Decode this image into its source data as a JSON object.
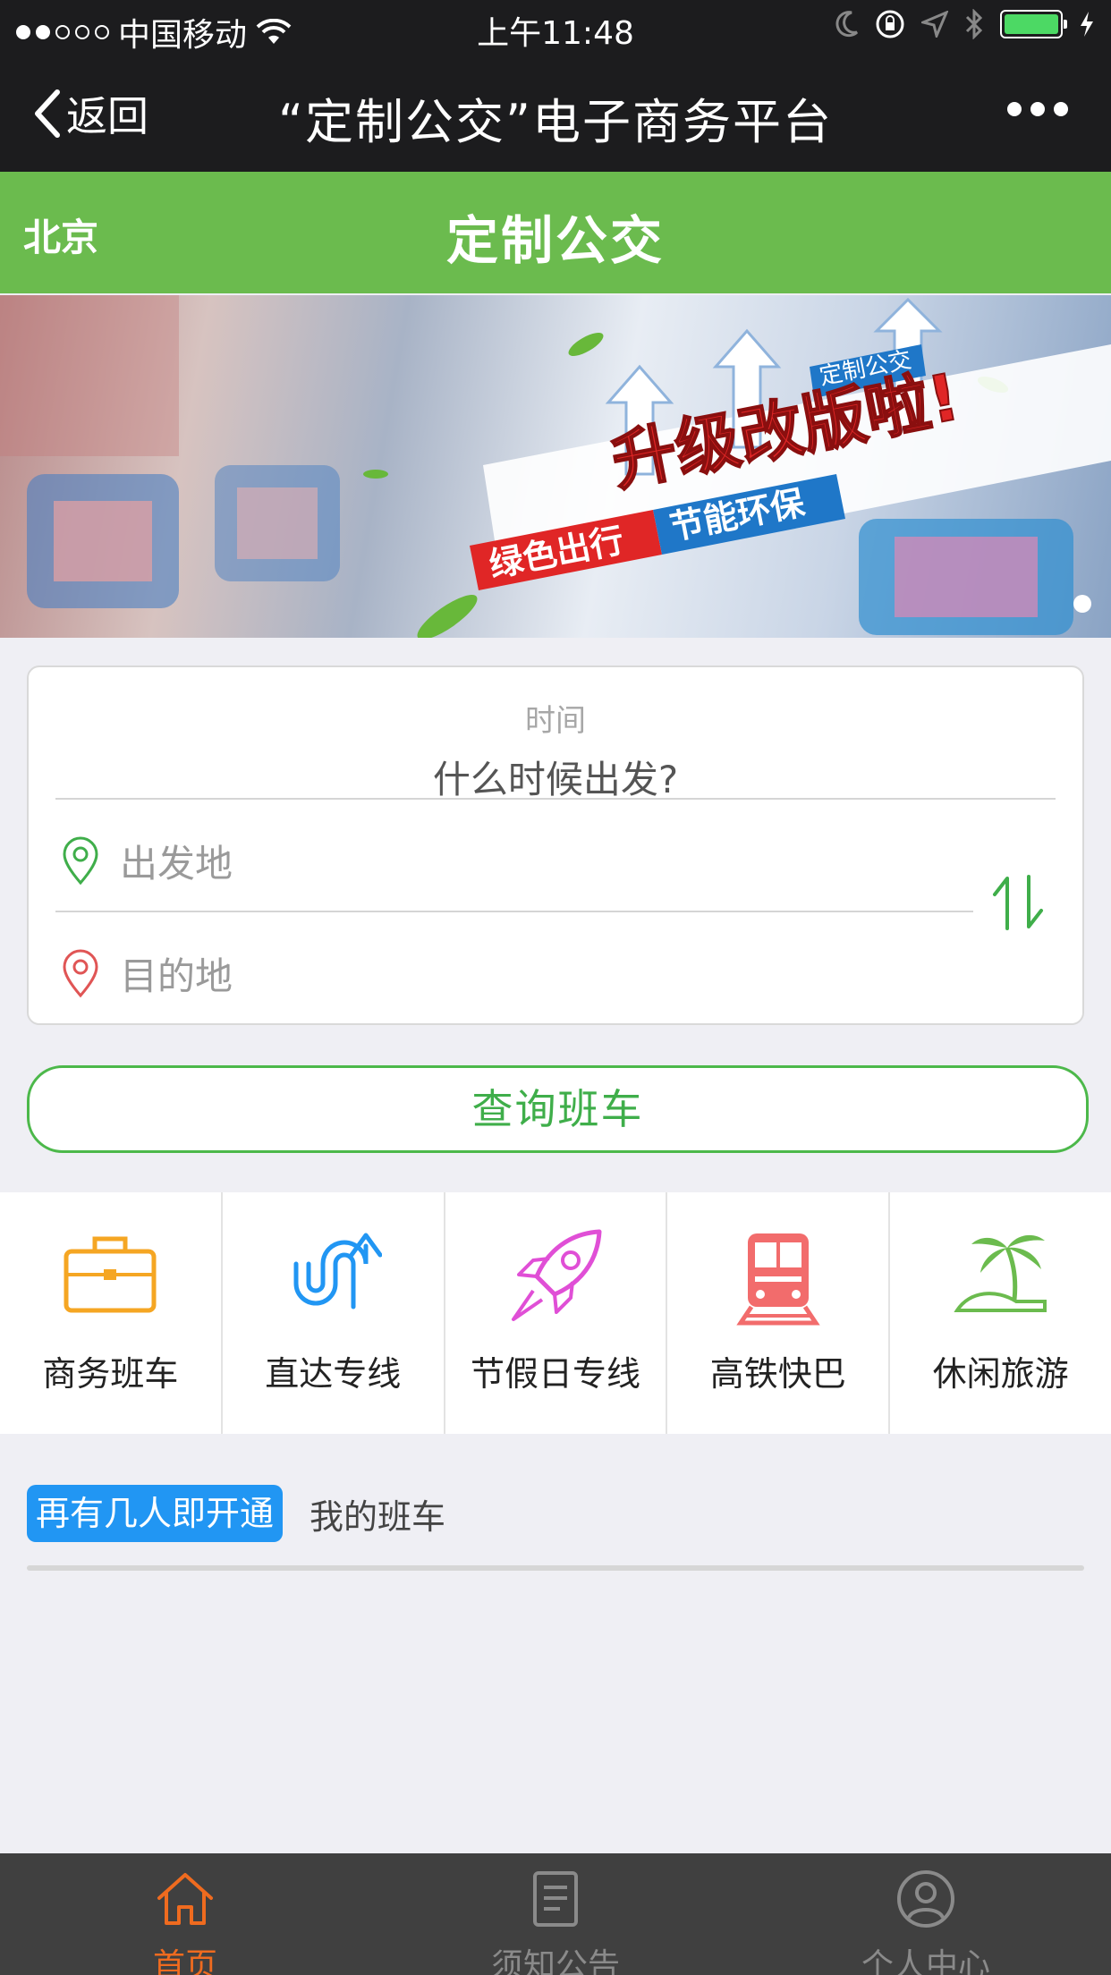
{
  "status_bar": {
    "carrier": "中国移动",
    "time": "上午11:48"
  },
  "nav": {
    "back_label": "返回",
    "title": "“定制公交”电子商务平台"
  },
  "header": {
    "city": "北京",
    "title": "定制公交"
  },
  "banner": {
    "tag": "定制公交",
    "headline": "升级改版啦!",
    "slogan_left": "绿色出行",
    "slogan_right": "节能环保"
  },
  "search": {
    "time_label": "时间",
    "time_placeholder": "什么时候出发?",
    "from_placeholder": "出发地",
    "to_placeholder": "目的地",
    "query_label": "查询班车"
  },
  "categories": [
    {
      "label": "商务班车",
      "icon": "briefcase-icon",
      "color": "#f5a623"
    },
    {
      "label": "直达专线",
      "icon": "u-turn-arrow-icon",
      "color": "#2196f3"
    },
    {
      "label": "节假日专线",
      "icon": "rocket-icon",
      "color": "#e04fd6"
    },
    {
      "label": "高铁快巴",
      "icon": "train-icon",
      "color": "#f26c6c"
    },
    {
      "label": "休闲旅游",
      "icon": "palm-island-icon",
      "color": "#6bbb4e"
    }
  ],
  "tabs": {
    "active": "再有几人即开通",
    "other": "我的班车"
  },
  "tabbar": [
    {
      "label": "首页",
      "icon": "home-icon",
      "active": true
    },
    {
      "label": "须知公告",
      "icon": "notice-icon",
      "active": false
    },
    {
      "label": "个人中心",
      "icon": "user-icon",
      "active": false
    }
  ],
  "colors": {
    "brand_green": "#6bbb4e",
    "tab_blue": "#2196f3",
    "active_orange": "#ef6b1f"
  }
}
